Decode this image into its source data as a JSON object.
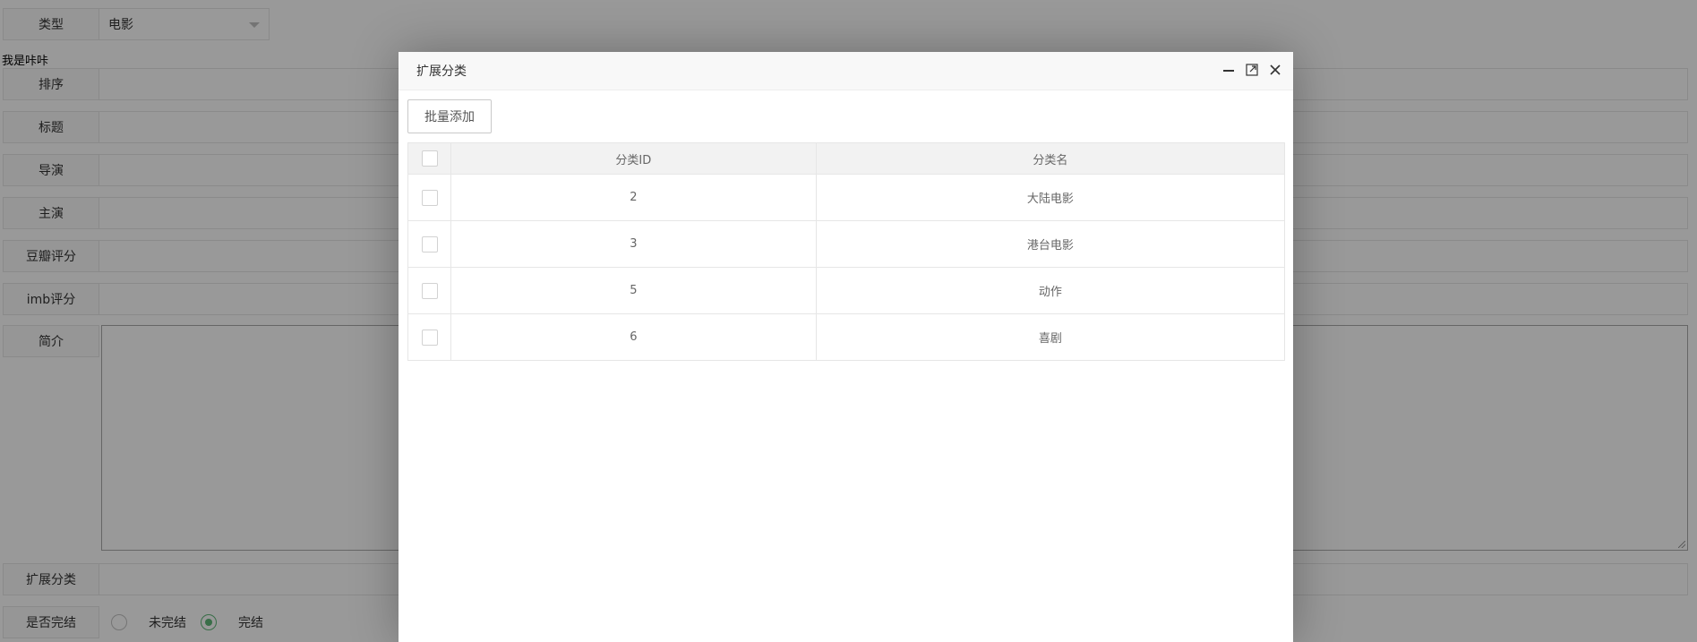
{
  "form": {
    "type_label": "类型",
    "type_value": "电影",
    "note": "我是咔咔",
    "sort_label": "排序",
    "title_label": "标题",
    "director_label": "导演",
    "actor_label": "主演",
    "douban_label": "豆瓣评分",
    "imdb_label": "imb评分",
    "intro_label": "简介",
    "ext_label": "扩展分类",
    "finished_label": "是否完结",
    "radio_unfinished": "未完结",
    "radio_finished": "完结",
    "radio_selected": "完结"
  },
  "dialog": {
    "title": "扩展分类",
    "batch_add": "批量添加",
    "columns": [
      "分类ID",
      "分类名"
    ],
    "rows": [
      {
        "id": "2",
        "name": "大陆电影"
      },
      {
        "id": "3",
        "name": "港台电影"
      },
      {
        "id": "5",
        "name": "动作"
      },
      {
        "id": "6",
        "name": "喜剧"
      }
    ]
  },
  "colors": {
    "accent": "#5FB878",
    "overlay": "rgba(0,0,0,0.4)"
  },
  "icons": {
    "minimize": "minimize-icon",
    "maximize": "maximize-icon",
    "close": "close-icon",
    "dropdown": "chevron-down-icon"
  }
}
